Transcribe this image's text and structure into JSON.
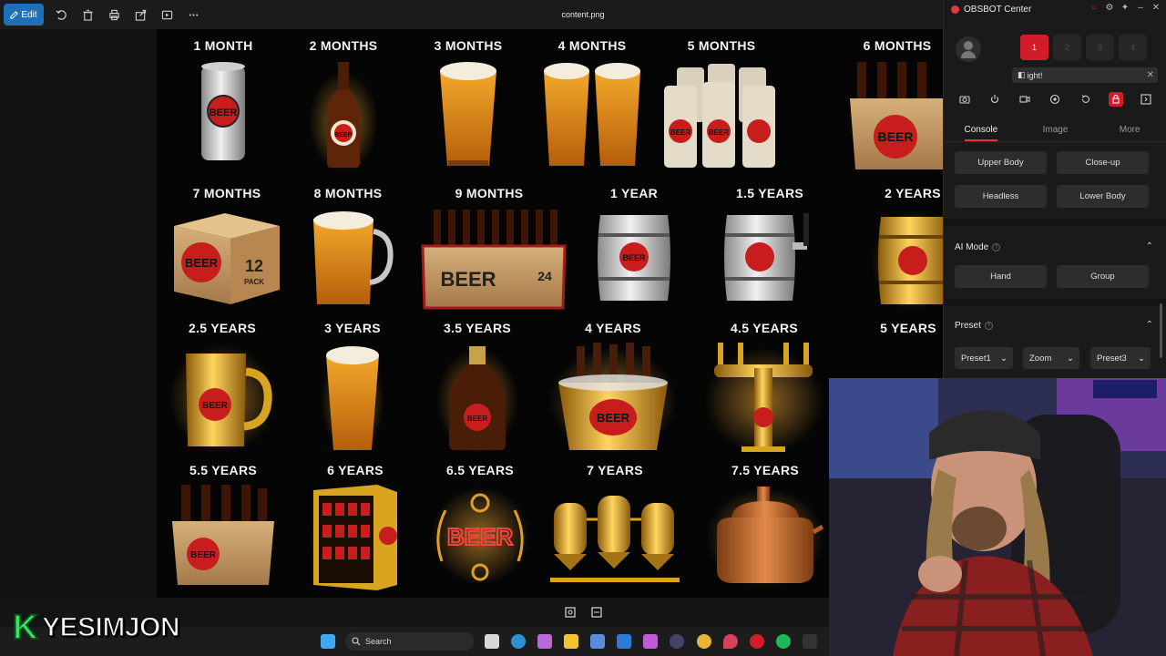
{
  "toolbar": {
    "edit_label": "Edit",
    "file_title": "content.png",
    "icons": [
      "rotate-icon",
      "delete-icon",
      "print-icon",
      "share-icon",
      "slideshow-icon",
      "more-icon"
    ]
  },
  "image": {
    "tiles": [
      {
        "label": "1 MONTH",
        "icon": "can"
      },
      {
        "label": "2 MONTHS",
        "icon": "bottle"
      },
      {
        "label": "3 MONTHS",
        "icon": "pint"
      },
      {
        "label": "4 MONTHS",
        "icon": "two-pints"
      },
      {
        "label": "5 MONTHS",
        "icon": "six-cans"
      },
      {
        "label": "6 MONTHS",
        "icon": "six-pack"
      },
      {
        "label": "7 MONTHS",
        "icon": "box-12"
      },
      {
        "label": "8 MONTHS",
        "icon": "pitcher"
      },
      {
        "label": "9 MONTHS",
        "icon": "crate-24"
      },
      {
        "label": "1 YEAR",
        "icon": "keg"
      },
      {
        "label": "1.5 YEARS",
        "icon": "keg-tap"
      },
      {
        "label": "2 YEARS",
        "icon": "gold-keg"
      },
      {
        "label": "2.5 YEARS",
        "icon": "gold-mug"
      },
      {
        "label": "3 YEARS",
        "icon": "pint"
      },
      {
        "label": "3.5 YEARS",
        "icon": "growler"
      },
      {
        "label": "4 YEARS",
        "icon": "bucket"
      },
      {
        "label": "4.5 YEARS",
        "icon": "tap-tower"
      },
      {
        "label": "5 YEARS",
        "icon": "hidden"
      },
      {
        "label": "5.5 YEARS",
        "icon": "six-pack"
      },
      {
        "label": "6 YEARS",
        "icon": "fridge"
      },
      {
        "label": "6.5 YEARS",
        "icon": "neon-sign"
      },
      {
        "label": "7 YEARS",
        "icon": "brewery"
      },
      {
        "label": "7.5 YEARS",
        "icon": "copper-kettle"
      }
    ],
    "text_beer": "BEER",
    "text_12": "12",
    "text_24": "24",
    "text_pack": "PACK"
  },
  "obsbot": {
    "title": "OBSBOT Center",
    "slots": [
      "1",
      "2",
      "3",
      "4"
    ],
    "notice": "ight!",
    "tabs": [
      "Console",
      "Image",
      "More"
    ],
    "framing_buttons": [
      "Upper Body",
      "Close-up",
      "Headless",
      "Lower Body"
    ],
    "ai_mode_title": "AI Mode",
    "ai_mode_buttons": [
      "Hand",
      "Group"
    ],
    "preset_title": "Preset",
    "presets": [
      "Preset1",
      "Zoom",
      "Preset3"
    ]
  },
  "taskbar": {
    "search_placeholder": "Search"
  },
  "overlay": {
    "brand_k": "K",
    "brand_name": "YESIMJON"
  },
  "colors": {
    "accent_blue": "#1f6fb9",
    "obsbot_red": "#d21c2a",
    "beer_red": "#c81d1d",
    "gold": "#d9a521"
  }
}
